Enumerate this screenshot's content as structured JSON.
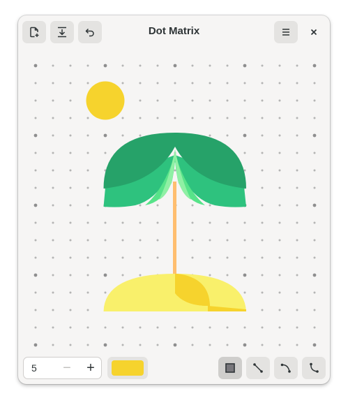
{
  "window": {
    "title": "Dot Matrix"
  },
  "header": {
    "new_button": "new-file",
    "export_button": "download",
    "undo_button": "undo",
    "menu_button": "hamburger-menu",
    "close_button": "close"
  },
  "toolbar": {
    "size_value": "5",
    "decrement_label": "−",
    "increment_label": "+",
    "current_color": "#f6d32d",
    "tools": [
      "rectangle",
      "line",
      "curve",
      "s-curve"
    ],
    "active_tool": "rectangle"
  },
  "palette": {
    "sun": "#f6d32d",
    "leaf_dark": "#26a269",
    "leaf_mid": "#2ec27e",
    "leaf_light": "#57e389",
    "leaf_lightest": "#8ff0a4",
    "trunk": "#ffbe6f",
    "sand": "#f9f06b",
    "sand_shadow": "#f6d32d",
    "dot_major": "#8e8e8e",
    "dot_minor": "#b4b4b4"
  }
}
